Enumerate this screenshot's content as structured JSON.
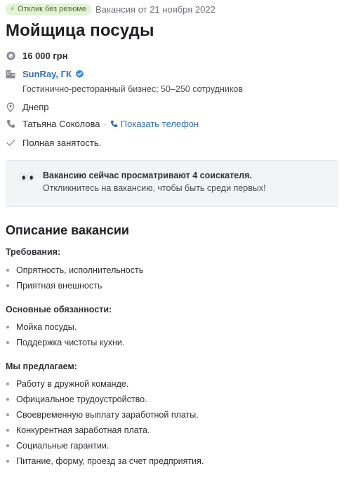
{
  "header": {
    "badge": "Отклик без резюме",
    "posted": "Вакансия от 21 ноября 2022",
    "title": "Мойщица посуды"
  },
  "details": {
    "salary": "16 000 грн",
    "company_name": "SunRay, ГК",
    "company_desc": "Гостинично-ресторанный бизнес; 50–250 сотрудников",
    "city": "Днепр",
    "contact_name": "Татьяна Соколова",
    "contact_sep": "·",
    "show_phone": "Показать телефон",
    "employment": "Полная занятость."
  },
  "notice": {
    "strong": "Вакансию сейчас просматривают 4 соискателя.",
    "sub": "Откликнитесь на вакансию, чтобы быть среди первых!"
  },
  "description": {
    "title": "Описание вакансии",
    "blocks": [
      {
        "heading": "Требования:",
        "items": [
          "Опрятность, исполнительность",
          "Приятная внешность"
        ]
      },
      {
        "heading": "Основные обязанности:",
        "items": [
          "Мойка посуды.",
          "Поддержка чистоты кухни."
        ]
      },
      {
        "heading": "Мы предлагаем:",
        "items": [
          "Работу в дружной команде.",
          "Официальное трудоустройство.",
          "Своевременную выплату заработной платы.",
          "Конкурентная заработная плата.",
          "Социальные гарантии.",
          "Питание, форму, проезд за счет предприятия."
        ]
      }
    ]
  },
  "colors": {
    "link": "#2e6fb5",
    "badge_bg": "#e3f3d6",
    "notice_bg": "#f2f4f6"
  },
  "icons": {
    "badge": "bolt-icon",
    "salary": "coin-icon",
    "company": "building-icon",
    "verified": "verified-check-icon",
    "city": "location-pin-icon",
    "contact": "phone-icon",
    "employment": "checkmark-icon",
    "notice": "eyes-icon"
  }
}
